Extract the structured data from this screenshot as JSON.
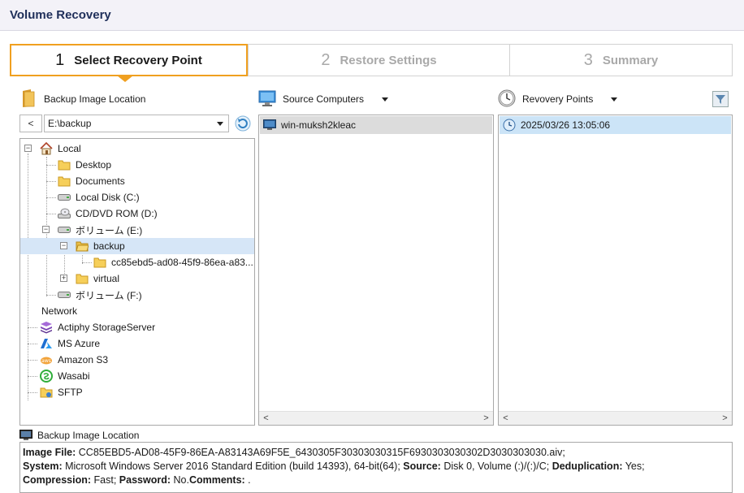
{
  "window": {
    "title": "Volume Recovery"
  },
  "wizard": {
    "steps": [
      {
        "num": "1",
        "label": "Select Recovery Point"
      },
      {
        "num": "2",
        "label": "Restore Settings"
      },
      {
        "num": "3",
        "label": "Summary"
      }
    ],
    "active_step": 0
  },
  "location_panel": {
    "header": "Backup Image Location",
    "back_label": "<",
    "path_value": "E:\\backup",
    "tree": {
      "local": "Local",
      "desktop": "Desktop",
      "documents": "Documents",
      "local_disk": "Local Disk (C:)",
      "cdrom": "CD/DVD ROM (D:)",
      "vol_e": "ボリューム (E:)",
      "backup": "backup",
      "backup_child": "cc85ebd5-ad08-45f9-86ea-a83...",
      "virtual": "virtual",
      "vol_f": "ボリューム (F:)",
      "network": "Network",
      "storage_server": "Actiphy StorageServer",
      "azure": "MS Azure",
      "s3": "Amazon S3",
      "wasabi": "Wasabi",
      "sftp": "SFTP"
    }
  },
  "computers_panel": {
    "header": "Source Computers",
    "items": [
      "win-muksh2kleac"
    ]
  },
  "points_panel": {
    "header": "Revovery Points",
    "items": [
      "2025/03/26 13:05:06"
    ]
  },
  "scroll": {
    "left": "<",
    "right": ">"
  },
  "info": {
    "title": "Backup Image Location",
    "image_file_label": "Image File:",
    "image_file_value": " CC85EBD5-AD08-45F9-86EA-A83143A69F5E_6430305F30303030315F6930303030302D3030303030.aiv;",
    "system_label": "System:",
    "system_value": " Microsoft Windows Server 2016 Standard Edition (build 14393), 64-bit(64); ",
    "source_label": "Source:",
    "source_value": " Disk 0, Volume (:)/(:)/C; ",
    "dedup_label": "Deduplication:",
    "dedup_value": " Yes;",
    "compression_label": "Compression:",
    "compression_value": " Fast; ",
    "password_label": "Password:",
    "password_value": " No.",
    "comments_label": "Comments:",
    "comments_value": " ."
  },
  "colors": {
    "accent": "#f0a020",
    "selection": "#d6e6f7",
    "title": "#1f2f5a"
  }
}
